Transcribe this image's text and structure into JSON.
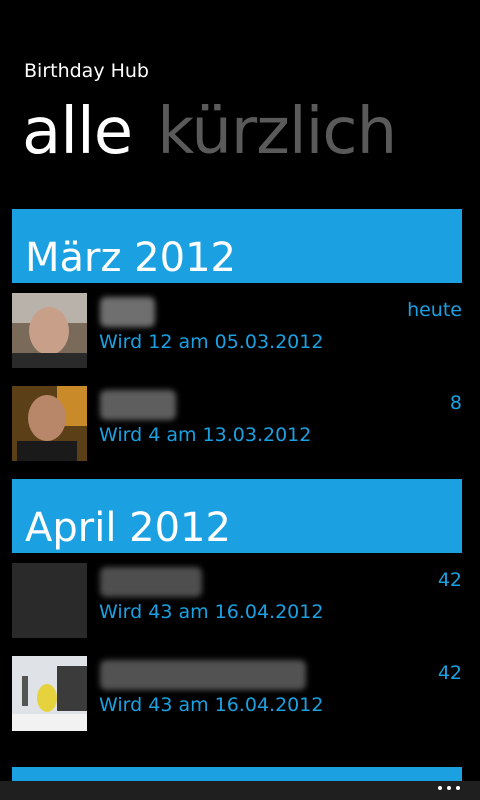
{
  "app": {
    "title": "Birthday Hub"
  },
  "pivot": {
    "tabs": [
      {
        "label": "alle"
      },
      {
        "label": "kürzlich"
      }
    ]
  },
  "groups": [
    {
      "header": "März 2012",
      "items": [
        {
          "subtitle": "Wird 12 am 05.03.2012",
          "right": "heute"
        },
        {
          "subtitle": "Wird 4 am 13.03.2012",
          "right": "8"
        }
      ]
    },
    {
      "header": "April 2012",
      "items": [
        {
          "subtitle": "Wird 43 am 16.04.2012",
          "right": "42"
        },
        {
          "subtitle": "Wird 43 am 16.04.2012",
          "right": "42"
        }
      ]
    }
  ],
  "colors": {
    "accent": "#1ba1e2",
    "background": "#000000",
    "inactive_tab": "#5a5a5a"
  },
  "app_bar": {
    "icon": "more-icon"
  }
}
